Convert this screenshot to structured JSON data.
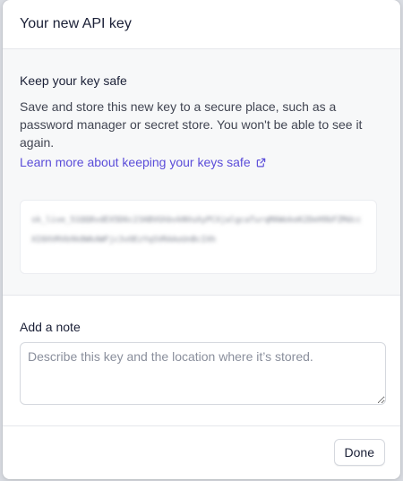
{
  "dialog": {
    "title": "Your new API key"
  },
  "key_section": {
    "heading": "Keep your key safe",
    "description": "Save and store this new key to a secure place, such as a password manager or secret store. You won't be able to see it again.",
    "learn_more_link": "Learn more about keeping your keys safe",
    "link_color": "#5b4dd9",
    "link_icon": "external-link-icon",
    "key_value": "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"
  },
  "note_section": {
    "label": "Add a note",
    "placeholder": "Describe this key and the location where it’s stored.",
    "value": ""
  },
  "footer": {
    "done_label": "Done"
  }
}
